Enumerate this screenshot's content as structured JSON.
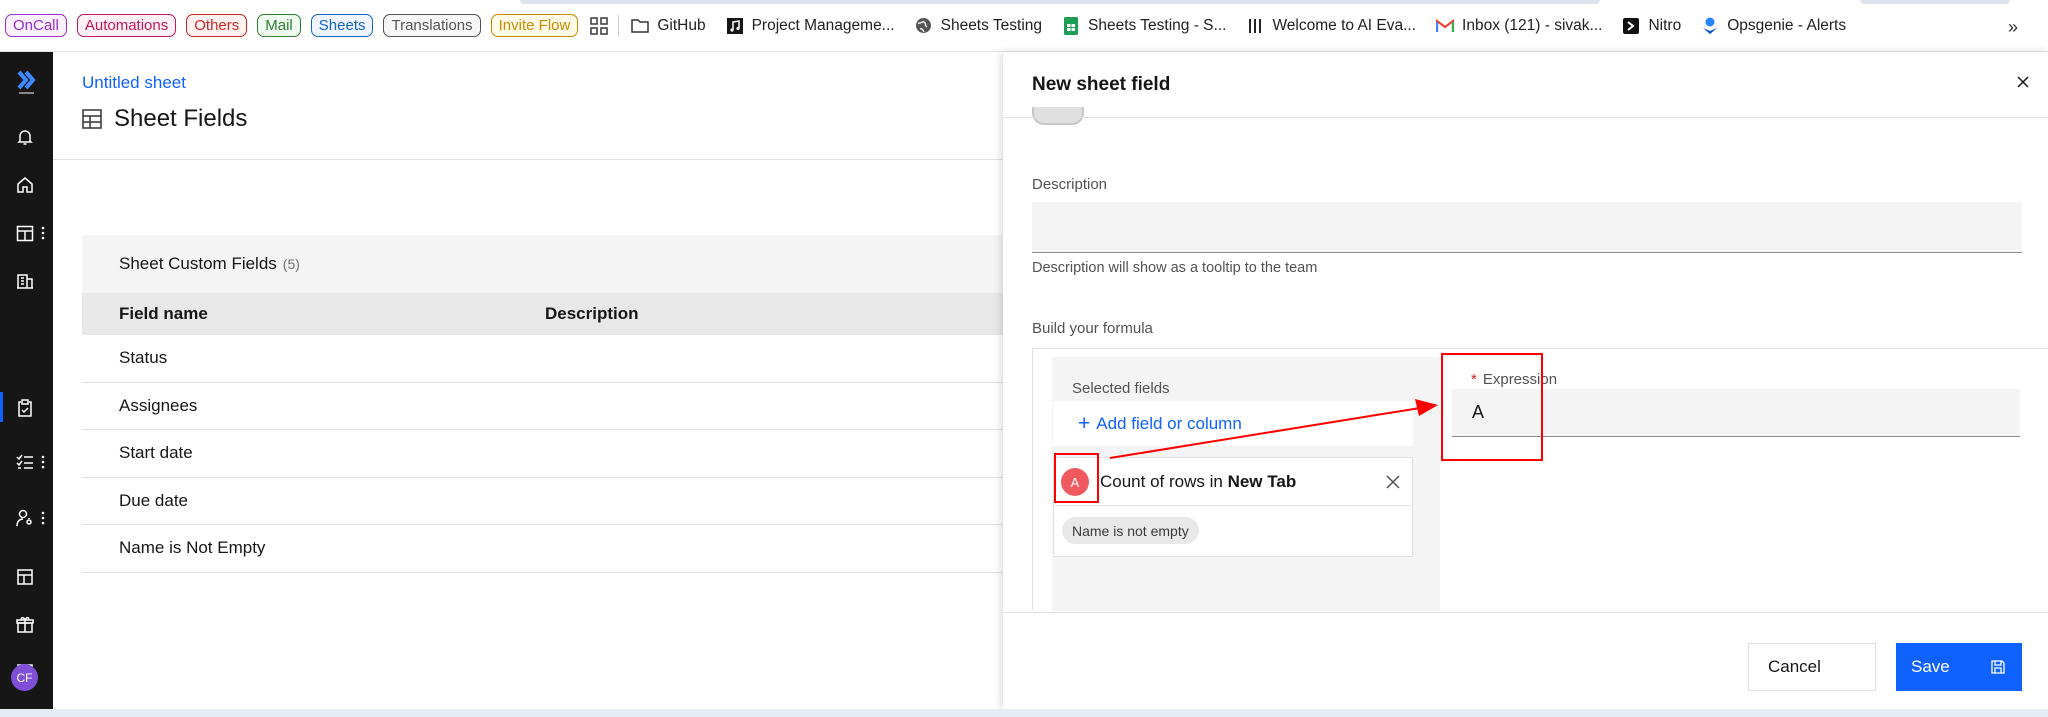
{
  "bookmarks": {
    "pills": [
      {
        "label": "OnCall",
        "color": "#9b2fc9",
        "bg": "#fbf0ff"
      },
      {
        "label": "Automations",
        "color": "#c2185b",
        "bg": "#fff0f6"
      },
      {
        "label": "Others",
        "color": "#c62828",
        "bg": "#fff2f0"
      },
      {
        "label": "Mail",
        "color": "#2e7d32",
        "bg": "#f0fbef"
      },
      {
        "label": "Sheets",
        "color": "#1565c0",
        "bg": "#eef5ff"
      },
      {
        "label": "Translations",
        "color": "#555555",
        "bg": "#f6f6f6"
      },
      {
        "label": "Invite Flow",
        "color": "#c68a00",
        "bg": "#fffbe8"
      }
    ],
    "links": [
      {
        "label": "GitHub",
        "icon": "folder-icon"
      },
      {
        "label": "Project Manageme...",
        "icon": "music-note-icon"
      },
      {
        "label": "Sheets Testing",
        "icon": "globe-icon"
      },
      {
        "label": "Sheets Testing - S...",
        "icon": "google-sheets-icon"
      },
      {
        "label": "Welcome to AI Eva...",
        "icon": "columns-icon"
      },
      {
        "label": "Inbox (121) - sivak...",
        "icon": "gmail-icon"
      },
      {
        "label": "Nitro",
        "icon": "nitro-icon"
      },
      {
        "label": "Opsgenie - Alerts",
        "icon": "opsgenie-icon"
      }
    ],
    "more": "»"
  },
  "nav": {
    "avatar": "CF"
  },
  "main": {
    "breadcrumb": "Untitled sheet",
    "title": "Sheet Fields",
    "card_title": "Sheet Custom Fields",
    "card_count": "(5)",
    "columns": [
      "Field name",
      "Description"
    ],
    "rows": [
      "Status",
      "Assignees",
      "Start date",
      "Due date",
      "Name is Not Empty"
    ]
  },
  "panel": {
    "title": "New sheet field",
    "description_label": "Description",
    "description_value": "",
    "description_helper": "Description will show as a tooltip to the team",
    "formula_label": "Build your formula",
    "selected_fields_label": "Selected fields",
    "add_field_label": "Add field or column",
    "field_chip": {
      "letter": "A",
      "text_prefix": "Count of rows in ",
      "text_bold": "New Tab",
      "filter_tag": "Name is not empty"
    },
    "expression_label": "Expression",
    "expression_required": "*",
    "expression_value": "A",
    "cancel_label": "Cancel",
    "save_label": "Save"
  }
}
